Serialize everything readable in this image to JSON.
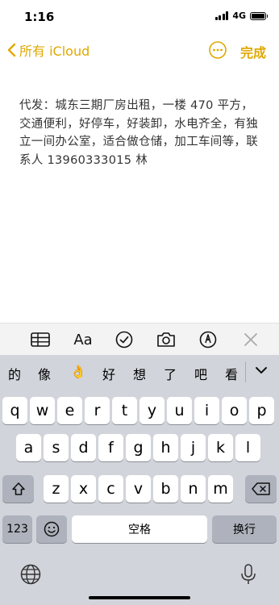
{
  "status": {
    "time": "1:16",
    "network": "4G"
  },
  "nav": {
    "back_label": "所有 iCloud",
    "done_label": "完成"
  },
  "note": {
    "text": "代发：城东三期厂房出租，一楼 470 平方，交通便利，好停车，好装卸，水电齐全，有独立一间办公室，适合做仓储，加工车间等，联系人 13960333015 林"
  },
  "toolbar": {
    "format_label": "Aa"
  },
  "candidates": [
    "的",
    "像",
    "👌",
    "好",
    "想",
    "了",
    "吧",
    "看"
  ],
  "keyboard": {
    "row1": [
      "q",
      "w",
      "e",
      "r",
      "t",
      "y",
      "u",
      "i",
      "o",
      "p"
    ],
    "row2": [
      "a",
      "s",
      "d",
      "f",
      "g",
      "h",
      "j",
      "k",
      "l"
    ],
    "row3": [
      "z",
      "x",
      "c",
      "v",
      "b",
      "n",
      "m"
    ],
    "numbers_label": "123",
    "space_label": "空格",
    "return_label": "换行"
  },
  "colors": {
    "accent": "#e0a800",
    "keyboard_bg": "#d1d4da"
  }
}
